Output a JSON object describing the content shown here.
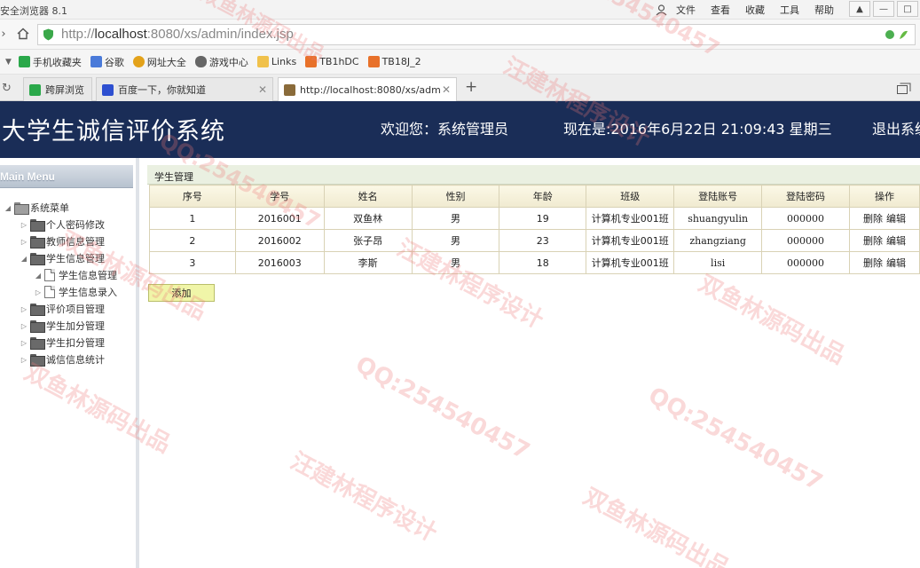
{
  "browser": {
    "app_title": "安全浏览器 8.1",
    "menus": [
      "文件",
      "查看",
      "收藏",
      "工具",
      "帮助"
    ],
    "url_prefix": "http://",
    "url_host": "localhost",
    "url_rest": ":8080/xs/admin/index.jsp",
    "bookmarks": [
      {
        "label": "手机收藏夹",
        "icon": "phone-icon",
        "color": "#2aa84a"
      },
      {
        "label": "谷歌",
        "icon": "google-icon",
        "color": "#4a7ad9"
      },
      {
        "label": "网址大全",
        "icon": "web-directory-icon",
        "color": "#e3a21a"
      },
      {
        "label": "游戏中心",
        "icon": "gamepad-icon",
        "color": "#666666"
      },
      {
        "label": "Links",
        "icon": "folder-icon",
        "color": "#f0c14b"
      },
      {
        "label": "TB1hDC",
        "icon": "tb-icon",
        "color": "#e8712a"
      },
      {
        "label": "TB18J_2",
        "icon": "tb-icon",
        "color": "#e8712a"
      }
    ],
    "tabs": [
      {
        "label": "跨屏浏览",
        "icon": "cross-screen-icon",
        "color": "#2aa84a"
      },
      {
        "label": "百度一下，你就知道",
        "icon": "baidu-icon",
        "color": "#2d4fd0"
      },
      {
        "label": "http://localhost:8080/xs/adm",
        "icon": "page-icon",
        "color": "#8a6b3a"
      }
    ],
    "new_tab_symbol": "+"
  },
  "header": {
    "title": "大学生诚信评价系统",
    "welcome": "欢迎您：系统管理员",
    "now": "现在是:2016年6月22日  21:09:43 星期三",
    "logout": "退出系统"
  },
  "sidebar": {
    "menu_title": "Main Menu",
    "root": "系统菜单",
    "items": [
      {
        "label": "个人密码修改",
        "expanded": false
      },
      {
        "label": "教师信息管理",
        "expanded": false
      },
      {
        "label": "学生信息管理",
        "expanded": true,
        "children": [
          "学生信息管理",
          "学生信息录入"
        ]
      },
      {
        "label": "评价项目管理",
        "expanded": false
      },
      {
        "label": "学生加分管理",
        "expanded": false
      },
      {
        "label": "学生扣分管理",
        "expanded": false
      },
      {
        "label": "诚信信息统计",
        "expanded": false
      }
    ]
  },
  "content": {
    "panel_title": "学生管理",
    "columns": [
      "序号",
      "学号",
      "姓名",
      "性别",
      "年龄",
      "班级",
      "登陆账号",
      "登陆密码",
      "操作"
    ],
    "rows": [
      [
        "1",
        "2016001",
        "双鱼林",
        "男",
        "19",
        "计算机专业001班",
        "shuangyulin",
        "000000"
      ],
      [
        "2",
        "2016002",
        "张子昂",
        "男",
        "23",
        "计算机专业001班",
        "zhangziang",
        "000000"
      ],
      [
        "3",
        "2016003",
        "李斯",
        "男",
        "18",
        "计算机专业001班",
        "lisi",
        "000000"
      ]
    ],
    "delete_label": "删除",
    "edit_label": "编辑",
    "add_label": "添加"
  },
  "watermarks": [
    "双鱼林源码出品",
    "汪建林程序设计",
    "QQ:254540457"
  ],
  "colors": {
    "header_bg": "#1a2d57",
    "add_button_bg": "#f0f5a8",
    "table_header_bg": "#f0ead0",
    "watermark": "#ec7878"
  }
}
